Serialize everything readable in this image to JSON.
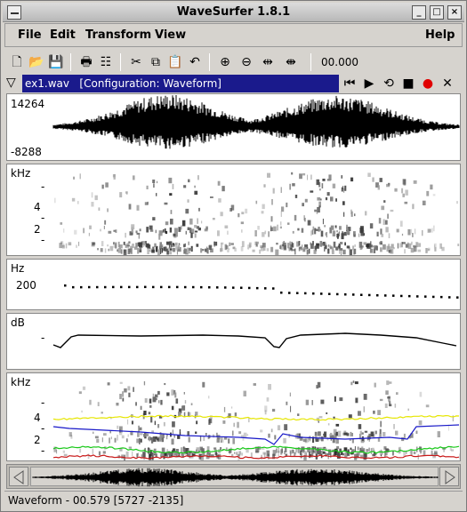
{
  "window": {
    "title": "WaveSurfer 1.8.1"
  },
  "menubar": {
    "items": [
      {
        "label": "File"
      },
      {
        "label": "Edit"
      },
      {
        "label": "Transform"
      },
      {
        "label": "View"
      }
    ],
    "help": "Help"
  },
  "toolbar": {
    "icons": [
      "new-file-icon",
      "open-folder-icon",
      "save-icon",
      "print-icon",
      "properties-icon",
      "cut-icon",
      "copy-icon",
      "paste-icon",
      "undo-icon",
      "zoom-in-icon",
      "zoom-out-icon",
      "zoom-fit-icon",
      "zoom-selection-icon"
    ],
    "time": "00.000"
  },
  "sound": {
    "label": "ex1.wav   [Configuration: Waveform]"
  },
  "waveform": {
    "max_label": "14264",
    "min_label": "-8288"
  },
  "spectrogram": {
    "unit": "kHz",
    "ticks": [
      "-",
      "4",
      "-",
      "2",
      "-"
    ]
  },
  "pitch": {
    "unit": "Hz",
    "tick": "200"
  },
  "power": {
    "unit": "dB",
    "tick": "-"
  },
  "formant": {
    "unit": "kHz",
    "ticks": [
      "-",
      "4",
      "-",
      "2",
      "-"
    ]
  },
  "colors": {
    "title_bar_selected": "#1a1a8c",
    "record": "#e00000",
    "formant_yellow": "#e6e600",
    "formant_blue": "#1818c8",
    "formant_green": "#18c818",
    "formant_red": "#c81818"
  },
  "status": {
    "text": "Waveform - 00.579 [5727 -2135]"
  }
}
